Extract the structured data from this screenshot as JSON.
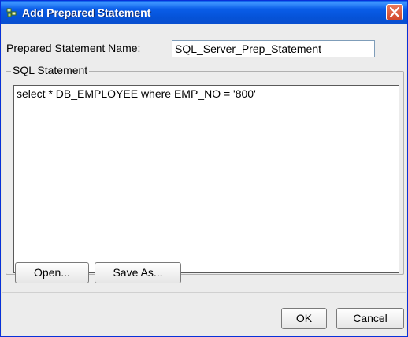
{
  "window": {
    "title": "Add Prepared Statement"
  },
  "form": {
    "name_label": "Prepared Statement Name:",
    "name_value": "SQL_Server_Prep_Statement",
    "group_label": "SQL Statement",
    "sql_text": "select * DB_EMPLOYEE where EMP_NO = '800'"
  },
  "buttons": {
    "open": "Open...",
    "save_as": "Save As...",
    "ok": "OK",
    "cancel": "Cancel"
  },
  "icons": {
    "title": "database-icon",
    "close": "close-icon"
  },
  "colors": {
    "titlebar": "#0a5de8",
    "close": "#d2472b",
    "dialog_bg": "#ececec"
  }
}
